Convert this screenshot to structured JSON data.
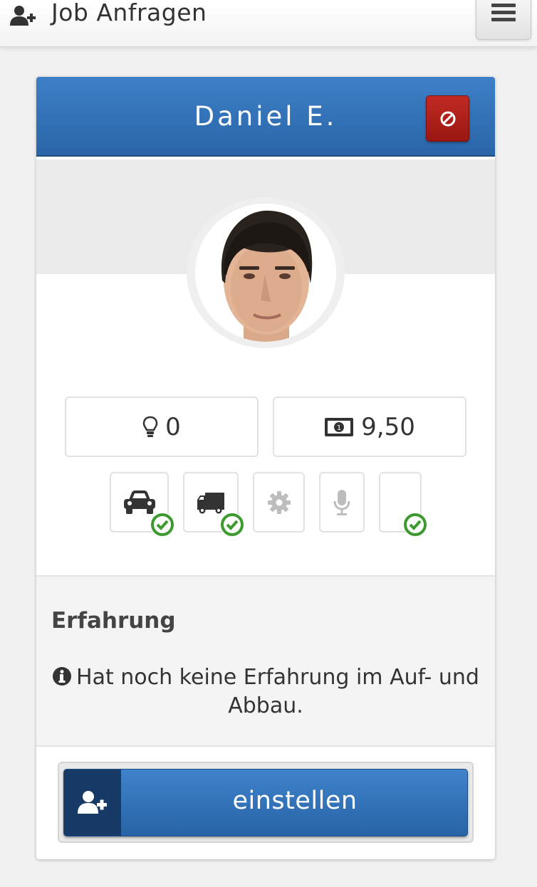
{
  "header": {
    "title": "Job Anfragen",
    "icon": "user-plus-icon",
    "menu_icon": "hamburger-menu-icon"
  },
  "profile": {
    "name": "Daniel E.",
    "block_icon": "ban-icon",
    "avatar": "profile-photo"
  },
  "stats": {
    "ideas_icon": "lightbulb-icon",
    "ideas_value": "0",
    "wage_icon": "money-bill-icon",
    "wage_value": "9,50"
  },
  "skills": [
    {
      "icon": "car-icon",
      "checked": true
    },
    {
      "icon": "truck-icon",
      "checked": true
    },
    {
      "icon": "gear-icon",
      "checked": false
    },
    {
      "icon": "microphone-icon",
      "checked": false
    },
    {
      "icon": "blank",
      "checked": true
    }
  ],
  "experience": {
    "title": "Erfahrung",
    "info_icon": "info-circle-icon",
    "text": "Hat noch keine Erfahrung im Auf- und Abbau."
  },
  "action": {
    "hire_label": "einstellen",
    "hire_icon": "user-plus-icon"
  },
  "colors": {
    "primary": "#2f6db5",
    "danger": "#b1201a",
    "check": "#3c9a2e"
  }
}
